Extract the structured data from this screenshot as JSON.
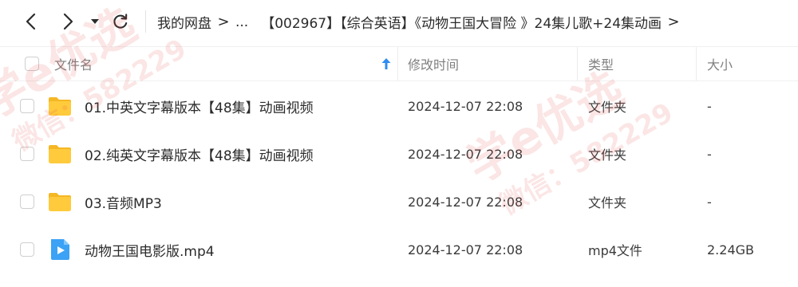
{
  "nav": {
    "back_icon": "chevron-left-icon",
    "forward_icon": "chevron-right-icon",
    "dropdown_icon": "caret-down-icon",
    "refresh_icon": "refresh-icon"
  },
  "breadcrumb": {
    "root": "我的网盘",
    "separator": ">",
    "ellipsis": "...",
    "current": "【002967】【综合英语】《动物王国大冒险 》24集儿歌+24集动画",
    "trailing_separator": ">"
  },
  "table": {
    "columns": {
      "name": "文件名",
      "modified": "修改时间",
      "type": "类型",
      "size": "大小"
    },
    "sort_icon": "arrow-up-icon",
    "rows": [
      {
        "name": "01.中英文字幕版本【48集】动画视频",
        "modified": "2024-12-07 22:08",
        "type": "文件夹",
        "size": "-",
        "icon": "folder-icon"
      },
      {
        "name": "02.纯英文字幕版本【48集】动画视频",
        "modified": "2024-12-07 22:08",
        "type": "文件夹",
        "size": "-",
        "icon": "folder-icon"
      },
      {
        "name": "03.音频MP3",
        "modified": "2024-12-07 22:08",
        "type": "文件夹",
        "size": "-",
        "icon": "folder-icon"
      },
      {
        "name": "动物王国电影版.mp4",
        "modified": "2024-12-07 22:08",
        "type": "mp4文件",
        "size": "2.24GB",
        "icon": "video-file-icon"
      }
    ]
  },
  "watermark": {
    "line1": "学e优选",
    "line2": "微信：582229"
  },
  "colors": {
    "folder": "#FFCB3D",
    "folder_dark": "#F5B724",
    "video": "#3BA2F5",
    "accent": "#2E8CF0",
    "watermark": "#E8413C"
  }
}
